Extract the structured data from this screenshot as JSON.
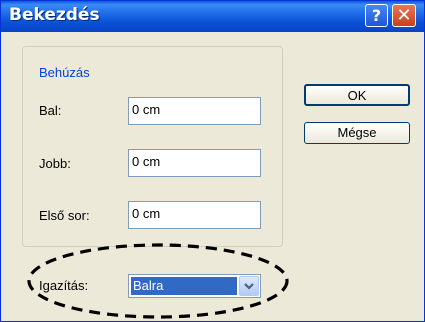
{
  "window": {
    "title": "Bekezdés",
    "help_symbol": "?",
    "close_symbol": "✕"
  },
  "indent": {
    "group_label": "Behúzás",
    "left_label": "Bal:",
    "left_value": "0 cm",
    "right_label": "Jobb:",
    "right_value": "0 cm",
    "first_label": "Első sor:",
    "first_value": "0 cm"
  },
  "alignment": {
    "label": "Igazítás:",
    "selected": "Balra"
  },
  "buttons": {
    "ok": "OK",
    "cancel": "Mégse"
  },
  "colors": {
    "title_bar": "#0a50d6",
    "selection": "#316ac5",
    "group_label": "#0046d5",
    "annotation_ellipse": "#000000"
  }
}
